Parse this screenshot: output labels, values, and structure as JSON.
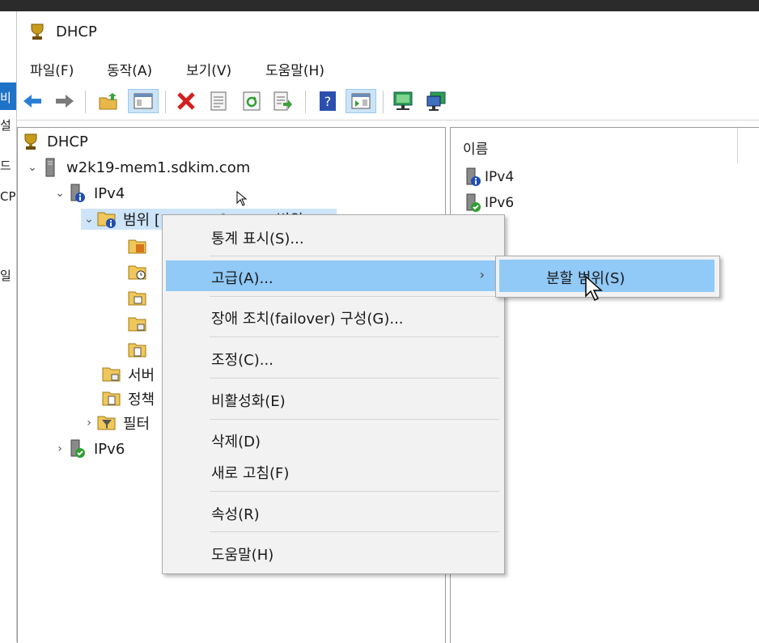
{
  "window": {
    "title": "DHCP"
  },
  "menubar": [
    "파일(F)",
    "동작(A)",
    "보기(V)",
    "도움말(H)"
  ],
  "toolbar": [
    "back-icon",
    "forward-icon",
    "up-folder-icon",
    "show-hide-console-tree-icon",
    "delete-icon",
    "properties-icon",
    "refresh-icon",
    "export-list-icon",
    "help-icon",
    "show-hide-action-pane-icon",
    "server-icon",
    "server-add-icon"
  ],
  "left_strip": [
    "비",
    "설",
    "드",
    "CP",
    "일"
  ],
  "tree": {
    "root": "DHCP",
    "server": "w2k19-mem1.sdkim.com",
    "ipv4": "IPv4",
    "scope": "범위 [10.0.0.0] DHCP 범위",
    "scope_children": [
      "",
      "",
      "",
      "",
      ""
    ],
    "server_options": "서버",
    "policies": "정책",
    "filters": "필터",
    "ipv6": "IPv6"
  },
  "right_pane": {
    "column_header": "이름",
    "items": [
      "IPv4",
      "IPv6"
    ]
  },
  "context_menu": {
    "items": [
      {
        "label": "통계 표시(S)..."
      },
      {
        "label": "고급(A)...",
        "submenu": true,
        "active": true
      },
      {
        "label": "장애 조치(failover) 구성(G)..."
      },
      {
        "label": "조정(C)..."
      },
      {
        "label": "비활성화(E)"
      },
      {
        "label": "삭제(D)"
      },
      {
        "label": "새로 고침(F)"
      },
      {
        "label": "속성(R)"
      },
      {
        "label": "도움말(H)"
      }
    ],
    "submenu": {
      "items": [
        "분할 범위(S)"
      ]
    }
  }
}
